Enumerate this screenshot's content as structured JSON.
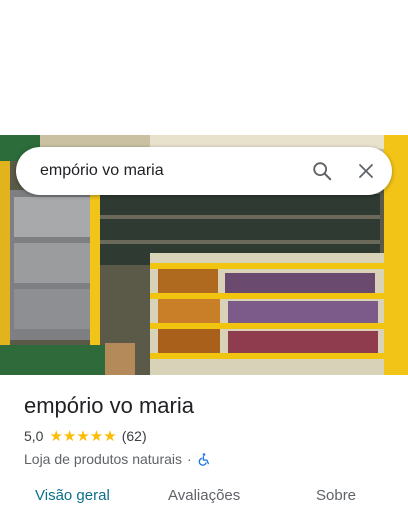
{
  "search": {
    "query": "empório vo maria"
  },
  "place": {
    "name": "empório vo maria",
    "rating": "5,0",
    "stars": "★★★★★",
    "review_count": "(62)",
    "category": "Loja de produtos naturais",
    "separator": "·",
    "accessibility": "wheelchair-icon"
  },
  "tabs": [
    {
      "label": "Visão geral",
      "active": true
    },
    {
      "label": "Avaliações",
      "active": false
    },
    {
      "label": "Sobre",
      "active": false
    }
  ],
  "colors": {
    "accent": "#0b6f8a",
    "star": "#fbbc04",
    "accessibility": "#1a73e8"
  }
}
